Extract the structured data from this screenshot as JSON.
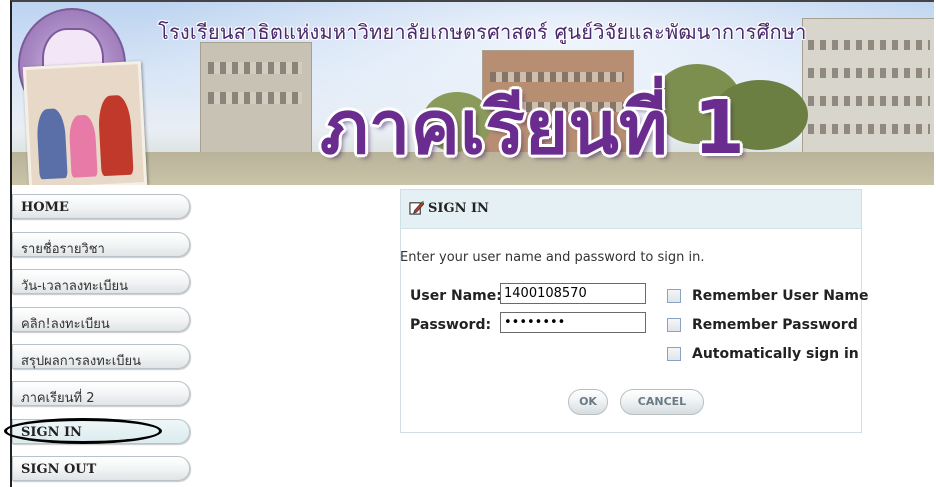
{
  "banner": {
    "school_name": "โรงเรียนสาธิตแห่งมหาวิทยาลัยเกษตรศาสตร์ ศูนย์วิจัยและพัฒนาการศึกษา",
    "term_title": "ภาคเรียนที่ 1"
  },
  "sidebar": {
    "items": [
      {
        "label": "HOME"
      },
      {
        "label": "รายชื่อรายวิชา"
      },
      {
        "label": "วัน-เวลาลงทะเบียน"
      },
      {
        "label": "คลิก!ลงทะเบียน"
      },
      {
        "label": "สรุปผลการลงทะเบียน"
      },
      {
        "label": "ภาคเรียนที่ 2"
      },
      {
        "label": "SIGN IN"
      },
      {
        "label": "SIGN OUT"
      }
    ]
  },
  "signin": {
    "title": "SIGN IN",
    "intro": "Enter your user name and password to sign in.",
    "username_label": "User Name:",
    "username_value": "1400108570",
    "password_label": "Password:",
    "password_value": "••••••••",
    "remember_user": "Remember User Name",
    "remember_password": "Remember Password",
    "auto_signin": "Automatically sign in",
    "ok": "OK",
    "cancel": "CANCEL"
  },
  "colors": {
    "accent": "#6a2c8e",
    "panel_header": "#e4f0f3",
    "annotation": "#000000"
  },
  "icons": [
    "school-seal-icon",
    "pencil-icon"
  ]
}
